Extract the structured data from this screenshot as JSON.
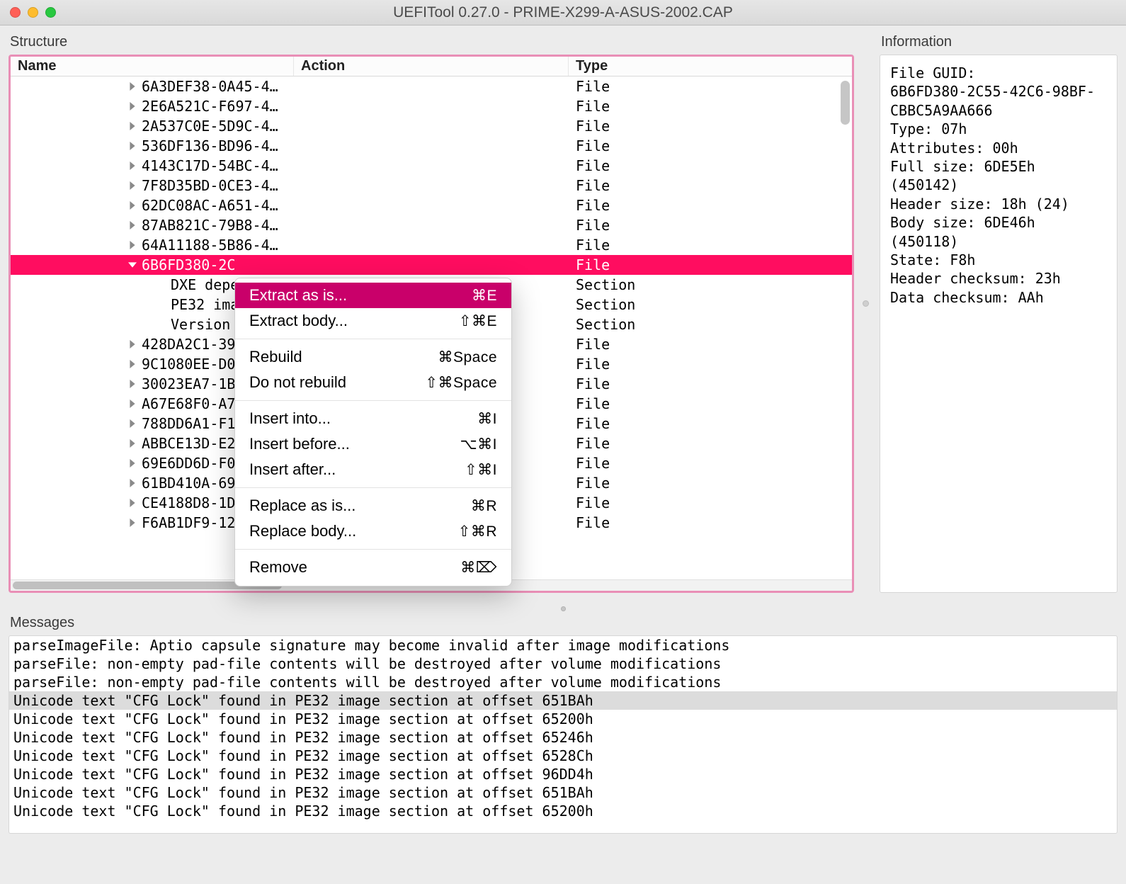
{
  "window": {
    "title": "UEFITool 0.27.0 - PRIME-X299-A-ASUS-2002.CAP"
  },
  "structure": {
    "label": "Structure",
    "columns": {
      "name": "Name",
      "action": "Action",
      "type": "Type"
    },
    "rows": [
      {
        "name": "6A3DEF38-0A45-4…",
        "type": "File",
        "expandable": true
      },
      {
        "name": "2E6A521C-F697-4…",
        "type": "File",
        "expandable": true
      },
      {
        "name": "2A537C0E-5D9C-4…",
        "type": "File",
        "expandable": true
      },
      {
        "name": "536DF136-BD96-4…",
        "type": "File",
        "expandable": true
      },
      {
        "name": "4143C17D-54BC-4…",
        "type": "File",
        "expandable": true
      },
      {
        "name": "7F8D35BD-0CE3-4…",
        "type": "File",
        "expandable": true
      },
      {
        "name": "62DC08AC-A651-4…",
        "type": "File",
        "expandable": true
      },
      {
        "name": "87AB821C-79B8-4…",
        "type": "File",
        "expandable": true
      },
      {
        "name": "64A11188-5B86-4…",
        "type": "File",
        "expandable": true
      },
      {
        "name": "6B6FD380-2C",
        "type": "File",
        "expandable": true,
        "expanded": true,
        "selected": true
      },
      {
        "name": "DXE depen",
        "type": "Section",
        "child": true
      },
      {
        "name": "PE32 imag",
        "type": "Section",
        "child": true
      },
      {
        "name": "Version s",
        "type": "Section",
        "child": true
      },
      {
        "name": "428DA2C1-39",
        "type": "File",
        "expandable": true
      },
      {
        "name": "9C1080EE-D0",
        "type": "File",
        "expandable": true
      },
      {
        "name": "30023EA7-1B",
        "type": "File",
        "expandable": true
      },
      {
        "name": "A67E68F0-A7",
        "type": "File",
        "expandable": true
      },
      {
        "name": "788DD6A1-F1",
        "type": "File",
        "expandable": true
      },
      {
        "name": "ABBCE13D-E2",
        "type": "File",
        "expandable": true
      },
      {
        "name": "69E6DD6D-F0",
        "type": "File",
        "expandable": true
      },
      {
        "name": "61BD410A-69",
        "type": "File",
        "expandable": true
      },
      {
        "name": "CE4188D8-1D",
        "type": "File",
        "expandable": true
      },
      {
        "name": "F6AB1DF9-12",
        "type": "File",
        "expandable": true
      }
    ]
  },
  "info": {
    "label": "Information",
    "lines": [
      "File GUID:",
      "6B6FD380-2C55-42C6-98BF-",
      "CBBC5A9AA666",
      "Type: 07h",
      "Attributes: 00h",
      "Full size: 6DE5Eh (450142)",
      "Header size: 18h (24)",
      "Body size: 6DE46h (450118)",
      "State: F8h",
      "Header checksum: 23h",
      "Data checksum: AAh"
    ]
  },
  "context_menu": {
    "items": [
      {
        "label": "Extract as is...",
        "shortcut": "⌘E",
        "highlight": true
      },
      {
        "label": "Extract body...",
        "shortcut": "⇧⌘E"
      },
      {
        "sep": true
      },
      {
        "label": "Rebuild",
        "shortcut": "⌘Space"
      },
      {
        "label": "Do not rebuild",
        "shortcut": "⇧⌘Space"
      },
      {
        "sep": true
      },
      {
        "label": "Insert into...",
        "shortcut": "⌘I"
      },
      {
        "label": "Insert before...",
        "shortcut": "⌥⌘I"
      },
      {
        "label": "Insert after...",
        "shortcut": "⇧⌘I"
      },
      {
        "sep": true
      },
      {
        "label": "Replace as is...",
        "shortcut": "⌘R"
      },
      {
        "label": "Replace body...",
        "shortcut": "⇧⌘R"
      },
      {
        "sep": true
      },
      {
        "label": "Remove",
        "shortcut": "⌘⌦"
      }
    ]
  },
  "messages": {
    "label": "Messages",
    "lines": [
      {
        "t": "parseImageFile: Aptio capsule signature may become invalid after image modifications"
      },
      {
        "t": "parseFile: non-empty pad-file contents will be destroyed after volume modifications"
      },
      {
        "t": "parseFile: non-empty pad-file contents will be destroyed after volume modifications"
      },
      {
        "t": "Unicode text \"CFG Lock\" found in PE32 image section at offset 651BAh",
        "sel": true
      },
      {
        "t": "Unicode text \"CFG Lock\" found in PE32 image section at offset 65200h"
      },
      {
        "t": "Unicode text \"CFG Lock\" found in PE32 image section at offset 65246h"
      },
      {
        "t": "Unicode text \"CFG Lock\" found in PE32 image section at offset 6528Ch"
      },
      {
        "t": "Unicode text \"CFG Lock\" found in PE32 image section at offset 96DD4h"
      },
      {
        "t": "Unicode text \"CFG Lock\" found in PE32 image section at offset 651BAh"
      },
      {
        "t": "Unicode text \"CFG Lock\" found in PE32 image section at offset 65200h"
      }
    ]
  }
}
